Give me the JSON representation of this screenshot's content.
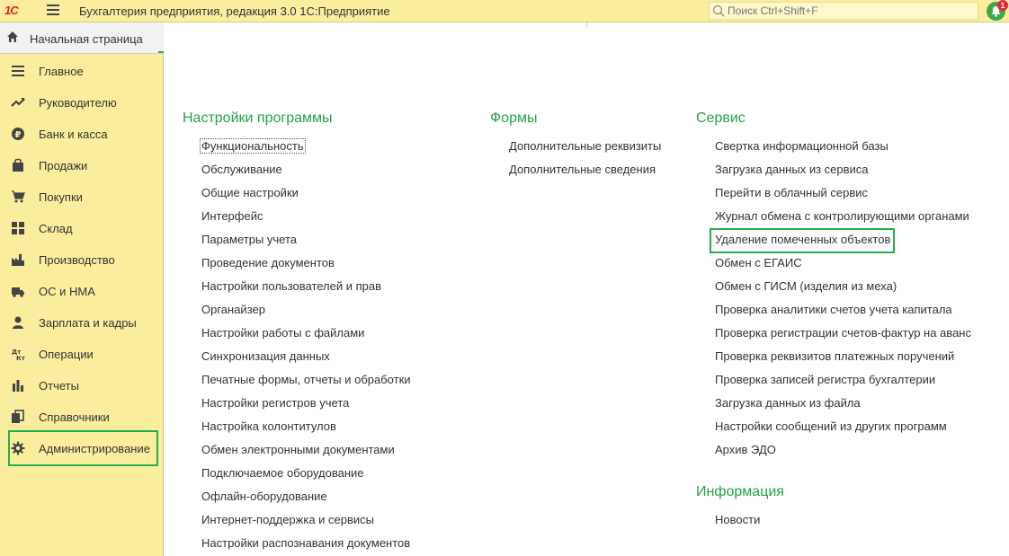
{
  "topbar": {
    "logo": "1С",
    "title": "Бухгалтерия предприятия, редакция 3.0 1С:Предприятие",
    "search_placeholder": "Поиск Ctrl+Shift+F",
    "notification_count": "1"
  },
  "home": {
    "label": "Начальная страница"
  },
  "sidebar": {
    "items": [
      {
        "label": "Главное",
        "icon": "menu-lines-icon"
      },
      {
        "label": "Руководителю",
        "icon": "trend-icon"
      },
      {
        "label": "Банк и касса",
        "icon": "ruble-icon"
      },
      {
        "label": "Продажи",
        "icon": "bag-icon"
      },
      {
        "label": "Покупки",
        "icon": "cart-icon"
      },
      {
        "label": "Склад",
        "icon": "grid-icon"
      },
      {
        "label": "Производство",
        "icon": "factory-icon"
      },
      {
        "label": "ОС и НМА",
        "icon": "truck-icon"
      },
      {
        "label": "Зарплата и кадры",
        "icon": "person-icon"
      },
      {
        "label": "Операции",
        "icon": "dt-kt-icon"
      },
      {
        "label": "Отчеты",
        "icon": "bar-chart-icon"
      },
      {
        "label": "Справочники",
        "icon": "books-icon"
      },
      {
        "label": "Администрирование",
        "icon": "gear-icon"
      }
    ]
  },
  "sections": {
    "settings": {
      "title": "Настройки программы",
      "links": [
        "Функциональность",
        "Обслуживание",
        "Общие настройки",
        "Интерфейс",
        "Параметры учета",
        "Проведение документов",
        "Настройки пользователей и прав",
        "Органайзер",
        "Настройки работы с файлами",
        "Синхронизация данных",
        "Печатные формы, отчеты и обработки",
        "Настройки регистров учета",
        "Настройка колонтитулов",
        "Обмен электронными документами",
        "Подключаемое оборудование",
        "Офлайн-оборудование",
        "Интернет-поддержка и сервисы",
        "Настройки распознавания документов"
      ]
    },
    "forms": {
      "title": "Формы",
      "links": [
        "Дополнительные реквизиты",
        "Дополнительные сведения"
      ]
    },
    "service": {
      "title": "Сервис",
      "links": [
        "Свертка информационной базы",
        "Загрузка данных из сервиса",
        "Перейти в облачный сервис",
        "Журнал обмена с контролирующими органами",
        "Удаление помеченных объектов",
        "Обмен с ЕГАИС",
        "Обмен с ГИСМ (изделия из меха)",
        "Проверка аналитики счетов учета капитала",
        "Проверка регистрации счетов-фактур на аванс",
        "Проверка реквизитов платежных поручений",
        "Проверка записей регистра бухгалтерии",
        "Загрузка данных из файла",
        "Настройки сообщений из других программ",
        "Архив ЭДО"
      ]
    },
    "info": {
      "title": "Информация",
      "links": [
        "Новости"
      ]
    }
  },
  "colors": {
    "sidebar_bg": "#fbed9e",
    "accent_green": "#25a24b",
    "highlight_green": "#21b14b",
    "logo_red": "#dd2222"
  }
}
